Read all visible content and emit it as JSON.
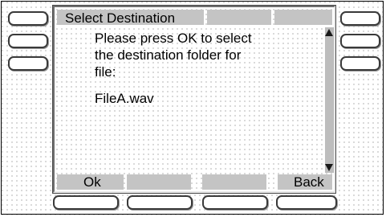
{
  "header": {
    "title": "Select Destination"
  },
  "message": {
    "lines": [
      "Please press OK to select",
      "the destination folder for",
      "file:"
    ],
    "filename": "FileA.wav"
  },
  "softkeys": {
    "ok": "Ok",
    "key2": "",
    "key3": "",
    "back": "Back"
  },
  "icons": {
    "scroll_up": "scroll-up-arrow",
    "scroll_down": "scroll-down-arrow"
  },
  "colors": {
    "bar_gray": "#c4c4c4",
    "scrollbar_gray": "#bdbdbd"
  }
}
